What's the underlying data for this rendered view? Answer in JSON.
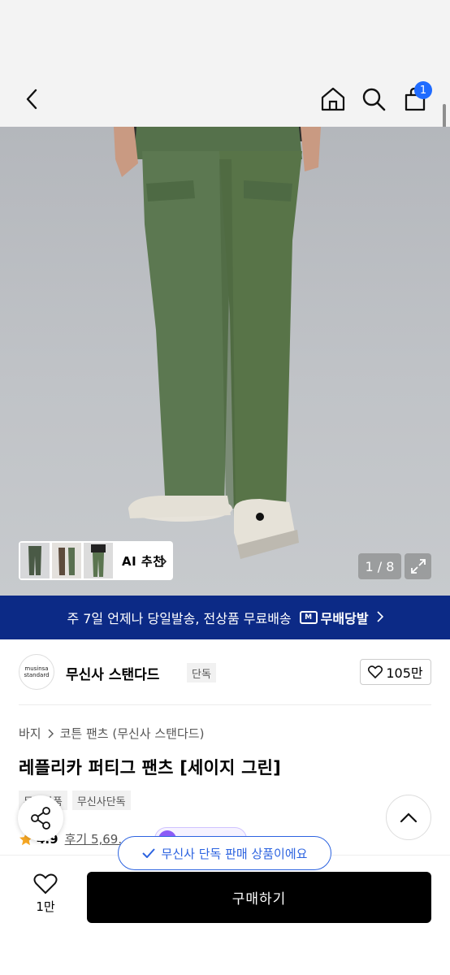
{
  "header": {
    "cart_count": "1"
  },
  "gallery": {
    "counter": "1 / 8",
    "ai_label": "AI 추천"
  },
  "banner": {
    "text": "주 7일 언제나 당일발송, 전상품 무료배송",
    "delivery_label": "무배당발",
    "delivery_mark": "M"
  },
  "brand": {
    "logo_text_1": "musinsa",
    "logo_text_2": "standard",
    "name": "무신사 스탠다드",
    "tag": "단독",
    "likes": "105만"
  },
  "product": {
    "breadcrumb": [
      "바지",
      "코튼 팬츠 (무신사 스탠다드)"
    ],
    "title": "레플리카 퍼티그 팬츠 [세이지 그린]",
    "tags": [
      "무신상품",
      "무신사단독"
    ],
    "rating": "4.9",
    "reviews": "후기 5,69..."
  },
  "toast": {
    "text": "무신사 단독 판매 상품이에요"
  },
  "bottom": {
    "wish_count": "1만",
    "buy_label": "구매하기"
  },
  "colors": {
    "banner_bg": "#0c2a86",
    "accent_blue": "#2c63e0",
    "pants_green": "#5a7650"
  }
}
